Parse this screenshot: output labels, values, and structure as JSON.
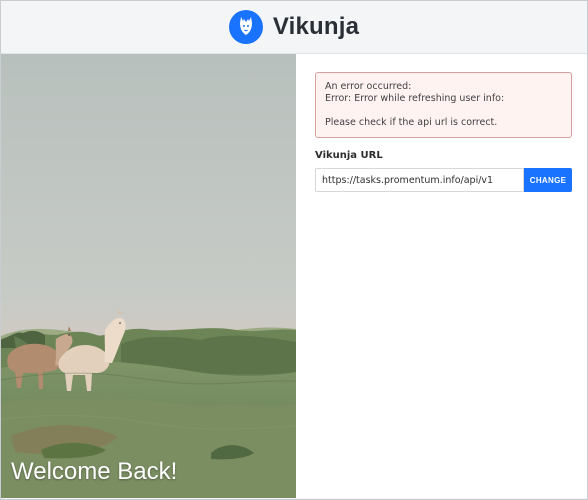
{
  "app": {
    "title": "Vikunja",
    "logo_icon": "llama-logo-icon",
    "accent": "#1973ff"
  },
  "hero": {
    "image": "alpacas-on-grassy-hill",
    "title": "Welcome Back!"
  },
  "error": {
    "line1": "An error occurred:",
    "line2": "Error: Error while refreshing user info:",
    "line3": "Please check if the api url is correct."
  },
  "url_form": {
    "label": "Vikunja URL",
    "value": "https://tasks.promentum.info/api/v1",
    "button_label": "CHANGE"
  }
}
